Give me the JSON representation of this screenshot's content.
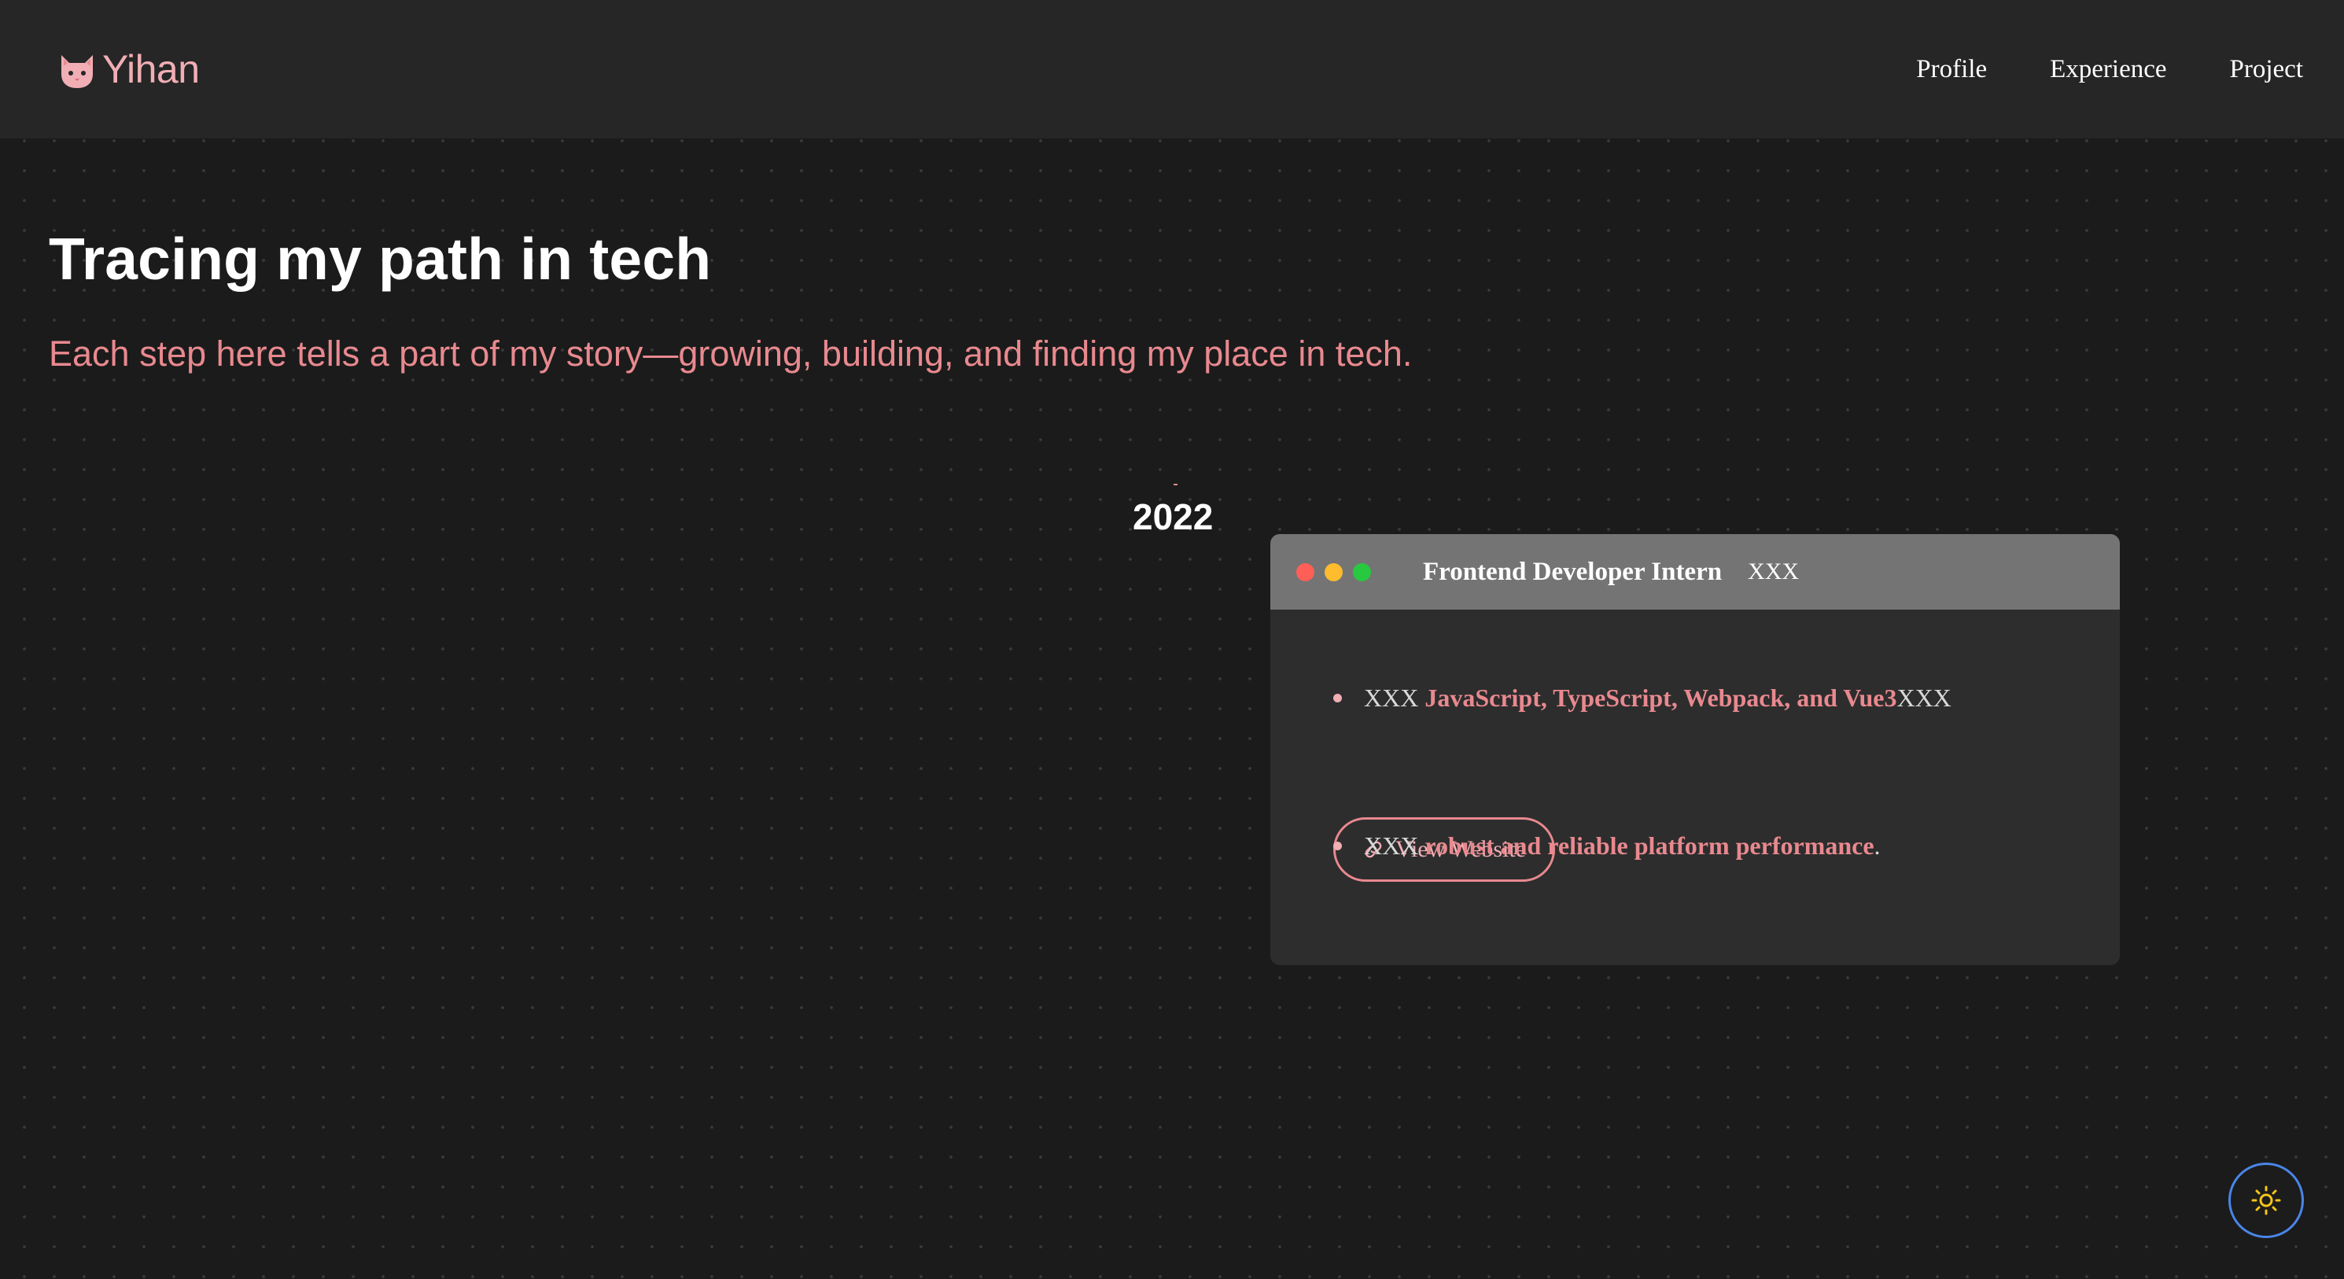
{
  "brand": {
    "name": "Yihan",
    "icon": "cat-face-icon"
  },
  "nav": {
    "items": [
      {
        "label": "Profile"
      },
      {
        "label": "Experience"
      },
      {
        "label": "Project"
      }
    ]
  },
  "hero": {
    "title": "Tracing my path in tech",
    "subtitle": "Each step here tells a part of my story—growing, building, and finding my place in tech."
  },
  "timeline": {
    "year": "2022",
    "card": {
      "title": "Frontend Developer Intern",
      "company": "XXX",
      "bullets": [
        {
          "prefix": "XXX ",
          "highlight": "JavaScript, TypeScript, Webpack, and Vue3",
          "suffix": "XXX"
        },
        {
          "prefix": "XXX ",
          "highlight": "robust and reliable platform performance",
          "suffix": "."
        }
      ],
      "link_label": "View Website",
      "link_icon": "link-icon"
    }
  },
  "theme_toggle": {
    "icon": "sun-icon"
  },
  "colors": {
    "background": "#1b1b1b",
    "navbar": "#262626",
    "accent_pink": "#e8898f",
    "card_header": "#747474",
    "card_body": "#2d2d2d",
    "toggle_border": "#4a86e8",
    "sun": "#f5c518",
    "dot_red": "#ff5f57",
    "dot_yellow": "#febc2e",
    "dot_green": "#28c840"
  }
}
